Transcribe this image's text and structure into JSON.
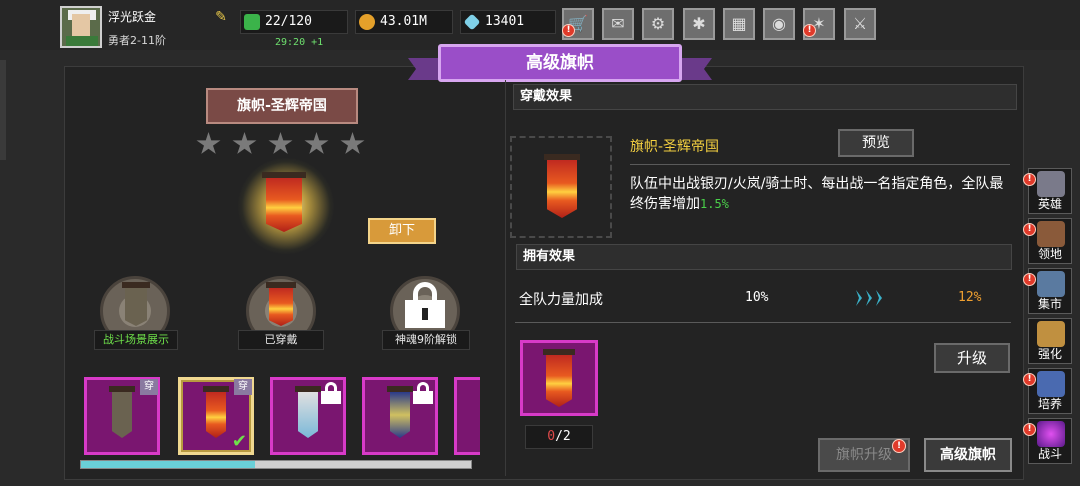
{
  "player": {
    "name": "浮光跃金",
    "rank": "勇者2-11阶"
  },
  "resources": {
    "stamina": "22/120",
    "stamina_timer": "29:20 +1",
    "gold": "43.01M",
    "gems": "13401"
  },
  "toolbar": {
    "icons": [
      "shop-icon",
      "mail-icon",
      "gamepad-icon",
      "gear-icon",
      "gift-icon",
      "palette-icon",
      "event-icon",
      "battle-pass-icon"
    ]
  },
  "title": "高级旗帜",
  "left": {
    "banner_name": "旗帜-圣辉帝国",
    "stars": 5,
    "unequip_label": "卸下",
    "pedestals": [
      {
        "label": "战斗场景展示",
        "color": "#6ee04a"
      },
      {
        "label": "已穿戴",
        "color": "#ffffff"
      },
      {
        "label": "神魂9阶解锁",
        "color": "#ffffff"
      }
    ],
    "slot_tag": "穿"
  },
  "right": {
    "wear_effect_header": "穿戴效果",
    "item_name": "旗帜-圣辉帝国",
    "preview_label": "预览",
    "description_main": "队伍中出战银刃/火岚/骑士时、每出战一名指定角色，全队最终伤害增加",
    "description_pct": "1.5%",
    "own_effect_header": "拥有效果",
    "own_stat_label": "全队力量加成",
    "own_stat_current": "10%",
    "own_stat_next": "12%",
    "upgrade_label": "升级",
    "material_have": "0",
    "material_need": "/2",
    "flag_upgrade_label": "旗帜升级",
    "advanced_flag_label": "高级旗帜"
  },
  "side_nav": [
    {
      "label": "英雄",
      "alert": true
    },
    {
      "label": "领地",
      "alert": true
    },
    {
      "label": "集市",
      "alert": true
    },
    {
      "label": "强化",
      "alert": false
    },
    {
      "label": "培养",
      "alert": true
    },
    {
      "label": "战斗",
      "alert": true
    }
  ],
  "colors": {
    "accent_purple": "#9a4ec8",
    "slot_magenta": "#7a1670",
    "highlight_green": "#4ad04a",
    "next_value_orange": "#f0a030",
    "item_name_yellow": "#f4d040"
  }
}
